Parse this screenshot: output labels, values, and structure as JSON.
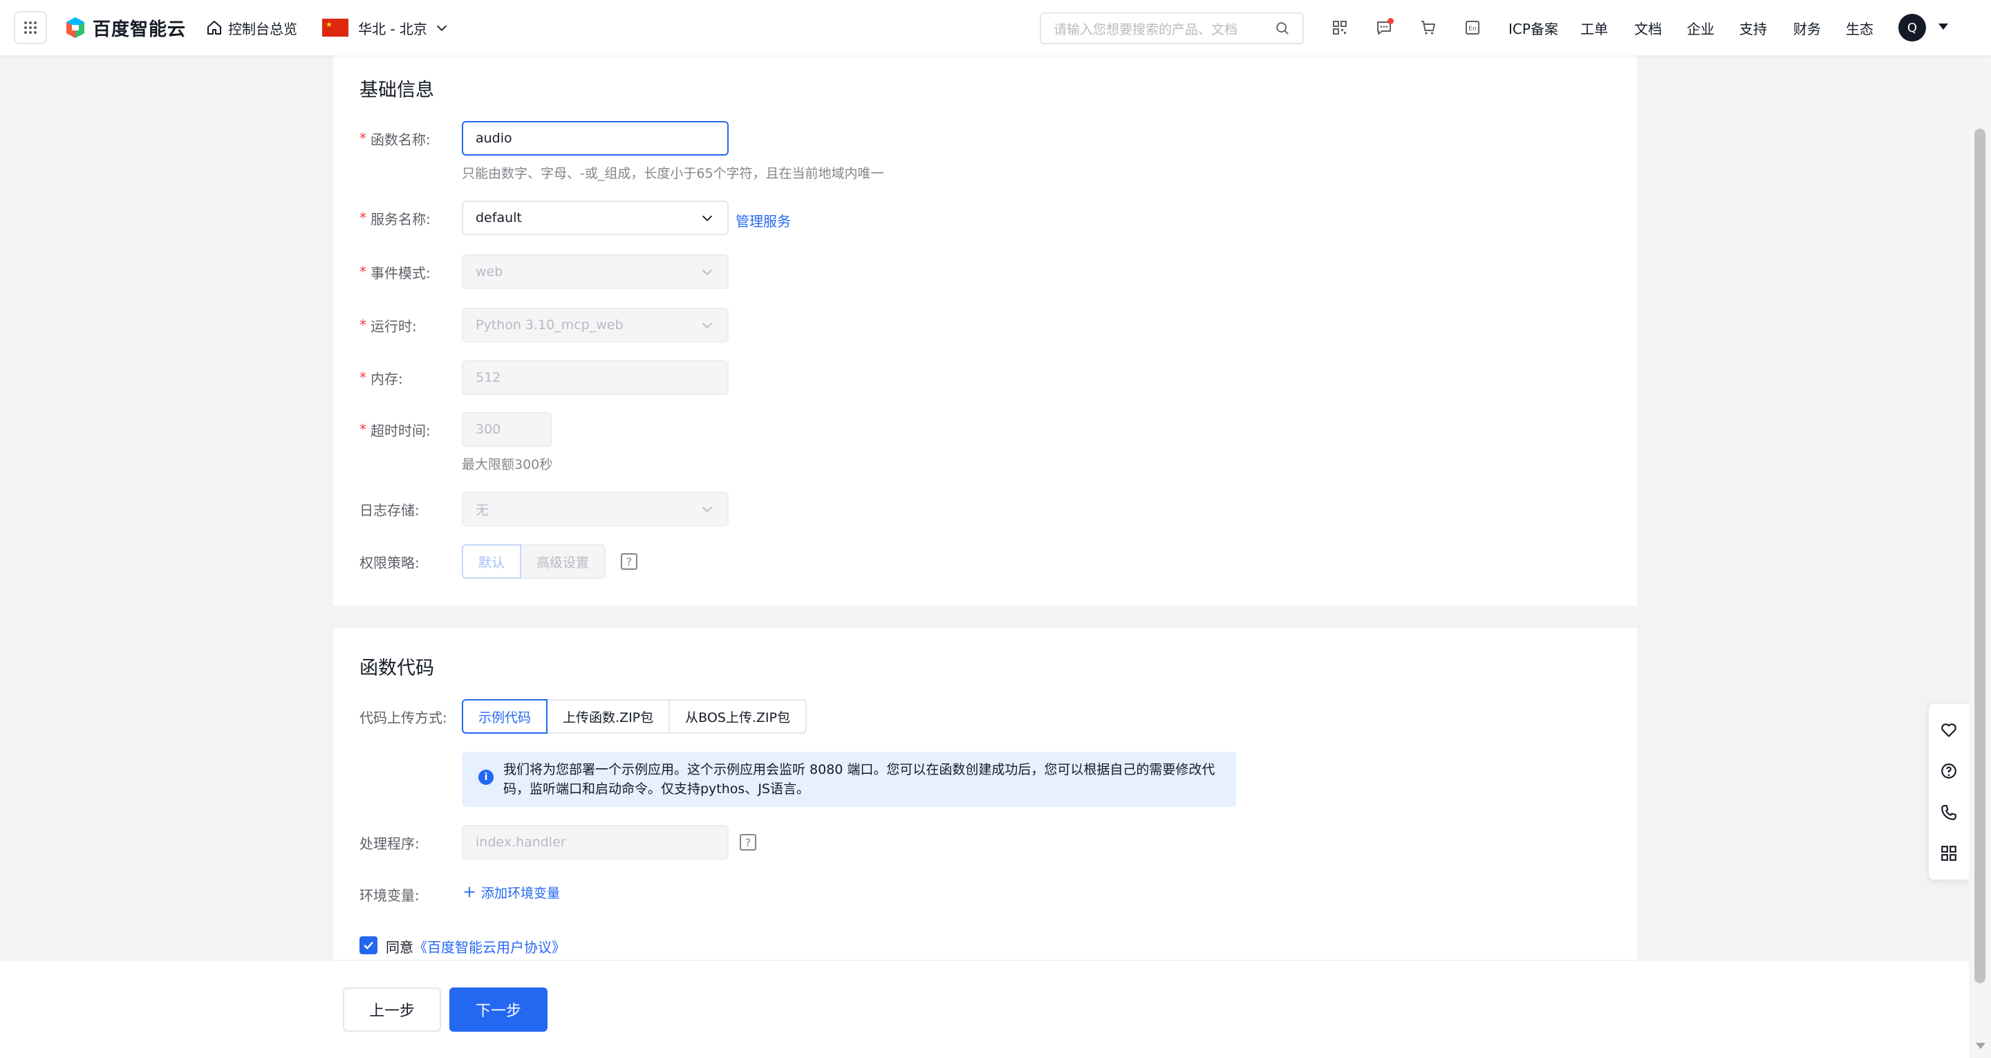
{
  "topbar": {
    "brand": "百度智能云",
    "console_overview": "控制台总览",
    "region": "华北 - 北京",
    "search_placeholder": "请输入您想要搜索的产品、文档",
    "links": [
      "ICP备案",
      "工单",
      "文档",
      "企业",
      "支持",
      "财务",
      "生态"
    ],
    "avatar_initial": "Q",
    "icons": [
      "grid-icon",
      "home-icon",
      "china-flag",
      "chevron-down-icon",
      "search-icon",
      "qrcode-icon",
      "message-icon",
      "cart-icon",
      "translate-icon"
    ]
  },
  "basic_info": {
    "title": "基础信息",
    "function_name": {
      "label": "函数名称:",
      "value": "audio",
      "hint": "只能由数字、字母、-或_组成，长度小于65个字符，且在当前地域内唯一"
    },
    "service_name": {
      "label": "服务名称:",
      "value": "default",
      "link": "管理服务"
    },
    "event_mode": {
      "label": "事件模式:",
      "value": "web"
    },
    "runtime": {
      "label": "运行时:",
      "value": "Python 3.10_mcp_web"
    },
    "memory": {
      "label": "内存:",
      "value": "512"
    },
    "timeout": {
      "label": "超时时间:",
      "value": "300",
      "hint": "最大限额300秒"
    },
    "log_storage": {
      "label": "日志存储:",
      "value": "无"
    },
    "permission": {
      "label": "权限策略:",
      "options": [
        "默认",
        "高级设置"
      ],
      "selected": "默认"
    }
  },
  "function_code": {
    "title": "函数代码",
    "upload_mode": {
      "label": "代码上传方式:",
      "options": [
        "示例代码",
        "上传函数.ZIP包",
        "从BOS上传.ZIP包"
      ],
      "selected": "示例代码"
    },
    "notice": "我们将为您部署一个示例应用。这个示例应用会监听 8080 端口。您可以在函数创建成功后，您可以根据自己的需要修改代码，监听端口和启动命令。仅支持pythos、JS语言。",
    "handler": {
      "label": "处理程序:",
      "placeholder": "index.handler"
    },
    "env_vars": {
      "label": "环境变量:",
      "add_link": "添加环境变量"
    },
    "agree": {
      "prefix": "同意",
      "link": "《百度智能云用户协议》",
      "checked": true
    }
  },
  "footer": {
    "prev": "上一步",
    "next": "下一步"
  },
  "float_bar": [
    "heart-icon",
    "help-circle-icon",
    "phone-icon",
    "apps-icon"
  ],
  "colors": {
    "primary": "#2468f2",
    "required": "#f33e3e",
    "background": "#f2f3f5"
  }
}
